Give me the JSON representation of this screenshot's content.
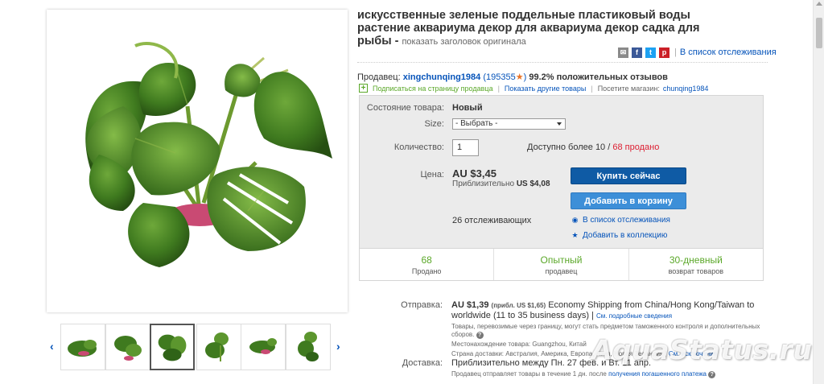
{
  "item": {
    "title": "искусственные зеленые поддельные пластиковый воды растение аквариума декор для аквариума декор садка для рыбы -",
    "show_original": "показать заголовок оригинала"
  },
  "share": {
    "icons": [
      "email-icon",
      "facebook-icon",
      "twitter-icon",
      "pinterest-icon"
    ],
    "watchlist": "В список отслеживания"
  },
  "seller": {
    "label": "Продавец:",
    "name": "xingchunqing1984",
    "feedback_count": "195355",
    "positive": "99.2% положительных отзывов",
    "subscribe": "Подписаться на страницу продавца",
    "other_items": "Показать другие товары",
    "store_label": "Посетите магазин:",
    "store": "chunqing1984"
  },
  "buybox": {
    "condition_label": "Состояние товара:",
    "condition": "Новый",
    "size_label": "Size:",
    "size_value": "- Выбрать -",
    "qty_label": "Количество:",
    "qty_value": "1",
    "avail_text": "Доступно более 10 /",
    "sold_text": "68 продано",
    "price_label": "Цена:",
    "price": "AU $3,45",
    "approx_label": "Приблизительно",
    "approx_value": "US $4,08",
    "buy_now": "Купить сейчас",
    "add_cart": "Добавить в корзину",
    "watchers": "26 отслеживающих",
    "add_watch": "В список отслеживания",
    "add_collection": "Добавить в коллекцию",
    "stats": [
      {
        "big": "68",
        "small": "Продано"
      },
      {
        "big": "Опытный",
        "small": "продавец"
      },
      {
        "big": "30-дневный",
        "small": "возврат товаров"
      }
    ]
  },
  "shipping": {
    "label": "Отправка:",
    "cost": "AU $1,39",
    "cost_approx": "(прибл. US $1,65)",
    "method": "Economy Shipping from China/Hong Kong/Taiwan to worldwide (11 to 35 business days)",
    "details_link": "См. подробные сведения",
    "note": "Товары, перевозимые через границу, могут стать предметом таможенного контроля и дополнительных сборов.",
    "location": "Местонахождение товара: Guangzhou, Китай",
    "countries": "Страна доставки: Австралия, Америка, Европа, Азия, Новая Зеландия",
    "countries_link": "См. исключения",
    "delivery_label": "Доставка:",
    "delivery": "Приблизительно между Пн. 27 фев. и Вт. 11 апр.",
    "delivery_note": "Продавец отправляет товары в течение 1 дн. после",
    "delivery_note_link": "получения погашенного платежа"
  },
  "watermark": "AquaStatus.ru",
  "colors": {
    "buy_button": "#0f5ba5",
    "cart_button": "#3d8fd8",
    "green": "#5ba829",
    "link": "#0654ba",
    "sold_red": "#dd1e31"
  }
}
